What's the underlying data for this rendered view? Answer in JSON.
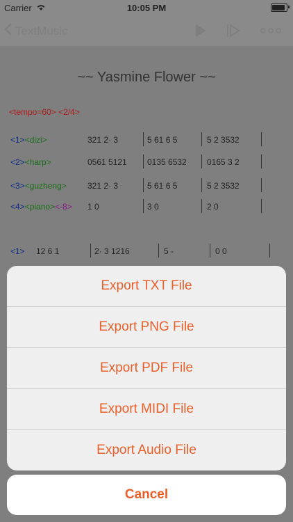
{
  "status": {
    "carrier": "Carrier",
    "time": "10:05 PM"
  },
  "navbar": {
    "back_label": "TextMusic"
  },
  "score": {
    "title": "~~ Yasmine Flower ~~",
    "tempo": "<tempo=60> <2/4>",
    "rows": [
      {
        "num": "<1>",
        "inst": "<dizi>",
        "extra": "",
        "measures": [
          "321  2· 3",
          "5 61 6 5",
          "5 2  3532"
        ]
      },
      {
        "num": "<2>",
        "inst": "<harp>",
        "extra": "",
        "measures": [
          "0561 5121",
          "0135 6532",
          "0165 3 2"
        ]
      },
      {
        "num": "<3>",
        "inst": "<guzheng>",
        "extra": "",
        "measures": [
          "321  2· 3",
          "5 61 6 5",
          "5 2  3532"
        ]
      },
      {
        "num": "<4>",
        "inst": "<piano>",
        "extra": "<-8>",
        "measures": [
          "1    0",
          "3    0",
          "2    0"
        ]
      }
    ],
    "row5": {
      "num": "<1>",
      "measures": [
        "12  6  1",
        "2· 3  1216",
        "5   -",
        "0   0"
      ]
    }
  },
  "sheet": {
    "items": [
      "Export TXT File",
      "Export PNG File",
      "Export PDF File",
      "Export MIDI File",
      "Export Audio File"
    ],
    "cancel": "Cancel"
  }
}
